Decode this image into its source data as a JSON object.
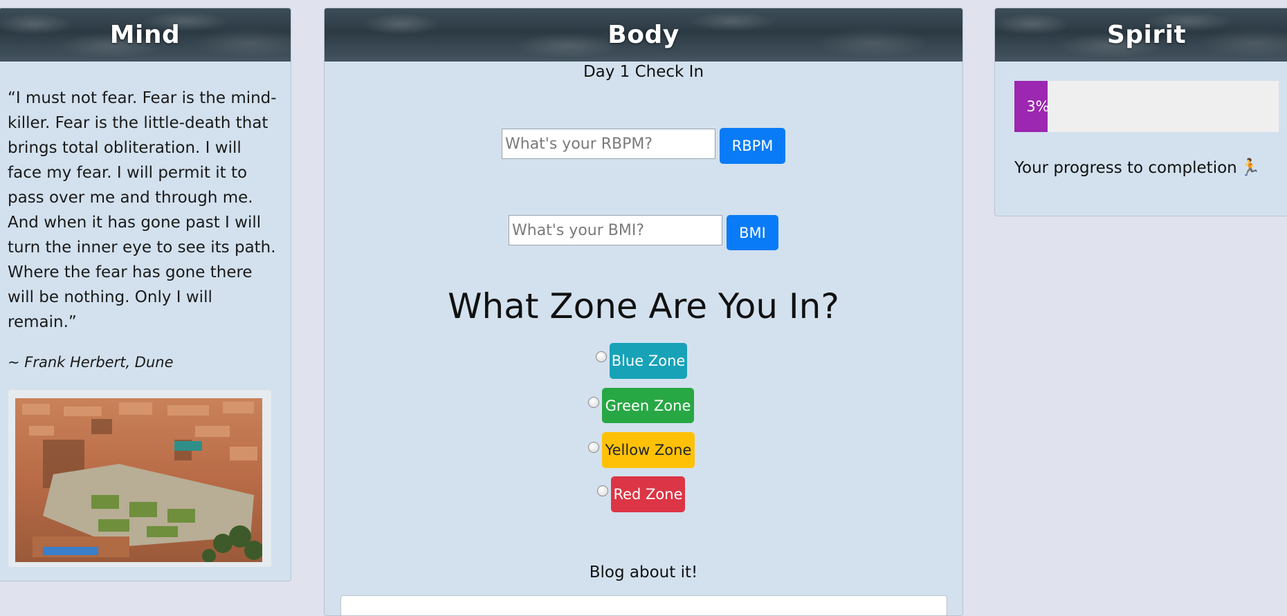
{
  "mind": {
    "title": "Mind",
    "quote": "“I must not fear. Fear is the mind-killer. Fear is the little-death that brings total obliteration. I will face my fear. I will permit it to pass over me and through me. And when it has gone past I will turn the inner eye to see its path. Where the fear has gone there will be nothing. Only I will remain.”",
    "author": "~ Frank Herbert, Dune"
  },
  "body": {
    "title": "Body",
    "checkin": "Day 1 Check In",
    "rbpm": {
      "placeholder": "What's your RBPM?",
      "button": "RBPM"
    },
    "bmi": {
      "placeholder": "What's your BMI?",
      "button": "BMI"
    },
    "zone_heading": "What Zone Are You In?",
    "zones": [
      {
        "label": "Blue Zone",
        "color": "#17a2b8"
      },
      {
        "label": "Green Zone",
        "color": "#28a745"
      },
      {
        "label": "Yellow Zone",
        "color": "#ffc107"
      },
      {
        "label": "Red Zone",
        "color": "#dc3545"
      }
    ],
    "blog_label": "Blog about it!"
  },
  "spirit": {
    "title": "Spirit",
    "progress_value": "3%",
    "progress_percent": 3,
    "progress_color": "#9c27b0",
    "caption": "Your progress to completion",
    "caption_icon": "running-person-icon"
  }
}
